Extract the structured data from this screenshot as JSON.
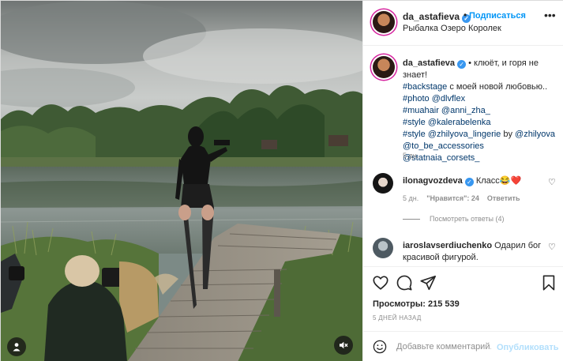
{
  "post": {
    "username": "da_astafieva",
    "follow_label": "Подписаться",
    "location": "Рыбалка Озеро Королек",
    "caption": {
      "username": "da_astafieva",
      "text": "• клюёт, и горя не знает!",
      "line2_tag": "#backstage",
      "line2_text": " с моей новой любовью..",
      "line3_tag1": "#photo",
      "line3_tag2": "@dlvflex",
      "line4_tag1": "#muahair",
      "line4_tag2": "@anni_zha_",
      "line5_tag1": "#style",
      "line5_tag2": "@kalerabelenka",
      "line6_tag1": "#style",
      "line6_tag2": "@zhilyova_lingerie",
      "line6_mid": " by ",
      "line6_tag3": "@zhilyova",
      "line7_tag1": "@to_be_accessories",
      "line7_tag2": "@statnaia_corsets_",
      "time": "5 дн."
    },
    "comments": [
      {
        "username": "ilonagvozdeva",
        "text": " Класс😂❤️",
        "time": "5 дн.",
        "likes": "\"Нравится\": 24",
        "reply": "Ответить",
        "view_replies": "Посмотреть ответы (4)"
      },
      {
        "username": "iaroslavserdiuchenko",
        "text": " Одарил бог красивой фигурой."
      }
    ],
    "views": "Просмотры: 215 539",
    "ago": "5 ДНЕЙ НАЗАД",
    "add_comment_placeholder": "Добавьте комментарий...",
    "publish_label": "Опубликовать"
  },
  "icons": {
    "verified": "✓",
    "more": "•••",
    "heart_small": "♡"
  }
}
